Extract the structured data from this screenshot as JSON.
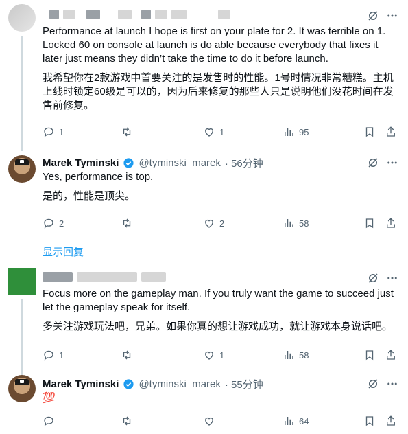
{
  "post1": {
    "text_en": "Performance at launch I hope is first on your plate for 2. It was terrible on 1. Locked 60 on console at launch is do able because everybody that fixes it later just means they didn’t take the time to do it before launch.",
    "text_zh": "我希望你在2款游戏中首要关注的是发售时的性能。1号时情况非常糟糕。主机上线时锁定60级是可以的，因为后来修复的那些人只是说明他们没花时间在发售前修复。",
    "replies": "1",
    "retweets": "",
    "likes": "1",
    "views": "95"
  },
  "reply1": {
    "name": "Marek Tyminski",
    "handle": "@tyminski_marek",
    "time": "· 56分钟",
    "text_en": "Yes, performance is top.",
    "text_zh": "是的，性能是顶尖。",
    "replies": "2",
    "likes": "2",
    "views": "58"
  },
  "show_replies": "显示回复",
  "post2": {
    "text_en": "Focus more on the gameplay man. If you truly want the game to succeed just let the gameplay speak for itself.",
    "text_zh": "多关注游戏玩法吧，兄弟。如果你真的想让游戏成功，就让游戏本身说话吧。",
    "replies": "1",
    "likes": "1",
    "views": "58"
  },
  "reply2": {
    "name": "Marek Tyminski",
    "handle": "@tyminski_marek",
    "time": "· 55分钟",
    "text_en": "💯",
    "views": "64"
  },
  "colors": {
    "accent": "#1d9bf0",
    "text": "#0f1419",
    "muted": "#536471",
    "divider": "#eff3f4"
  }
}
